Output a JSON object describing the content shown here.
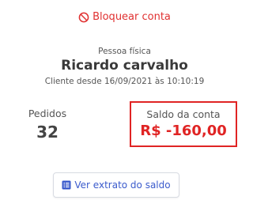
{
  "actions": {
    "block_account_label": "Bloquear conta",
    "block_icon": "ban-icon",
    "view_statement_label": "Ver extrato do saldo",
    "statement_icon": "list-icon"
  },
  "customer": {
    "type": "Pessoa física",
    "name": "Ricardo carvalho",
    "since": "Cliente desde 16/09/2021 às 10:10:19"
  },
  "stats": {
    "orders_label": "Pedidos",
    "orders_value": "32",
    "balance_label": "Saldo da conta",
    "balance_value": "R$ -160,00"
  },
  "colors": {
    "danger": "#e02424",
    "link": "#3b5bcc"
  }
}
